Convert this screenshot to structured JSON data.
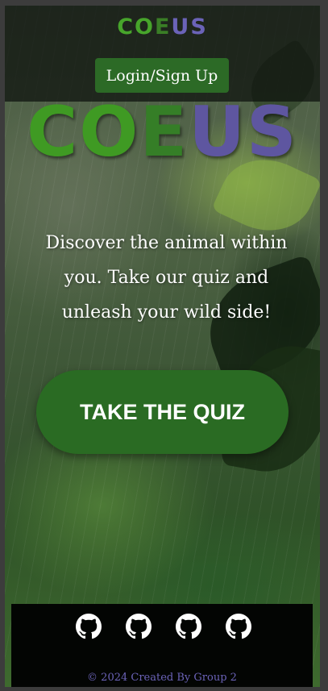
{
  "header": {
    "logo_parts": [
      "CO",
      "E",
      "US"
    ],
    "login_label": "Login/Sign Up"
  },
  "hero": {
    "logo_parts": [
      "CO",
      "E",
      "US"
    ],
    "tagline": "Discover the animal within you. Take our quiz and unleash your wild side!",
    "cta_label": "TAKE THE QUIZ"
  },
  "footer": {
    "icons": [
      "github-icon",
      "github-icon",
      "github-icon",
      "github-icon"
    ],
    "copyright": "© 2024 Created By Group 2"
  },
  "colors": {
    "green": "#47a52b",
    "purple": "#6b63b8",
    "button_green": "#2c6a26"
  }
}
